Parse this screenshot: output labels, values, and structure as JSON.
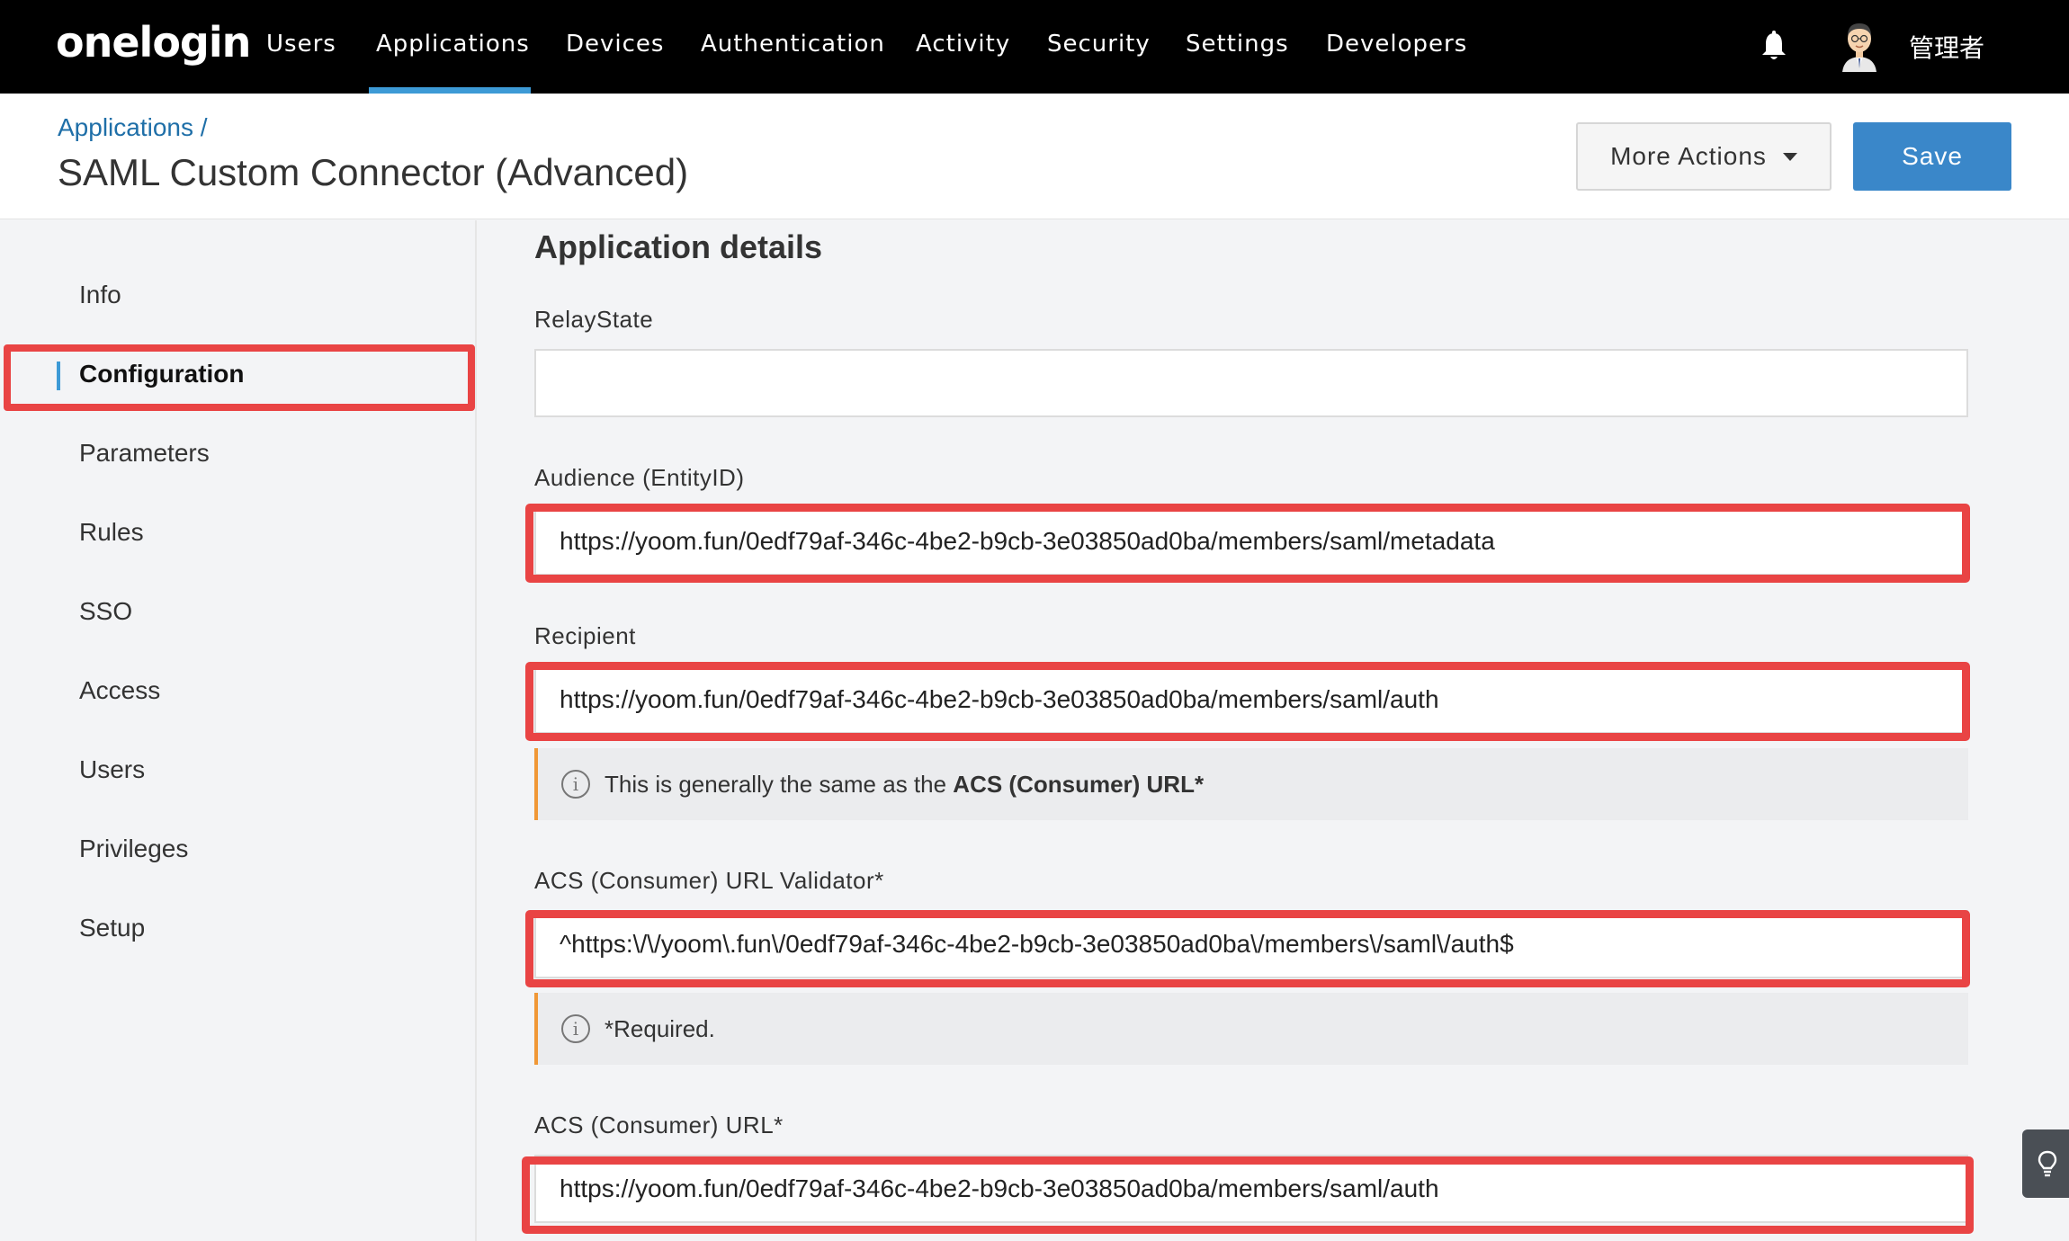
{
  "app": {
    "logo": "onelogin"
  },
  "nav": {
    "items": [
      "Users",
      "Applications",
      "Devices",
      "Authentication",
      "Activity",
      "Security",
      "Settings",
      "Developers"
    ],
    "active": "Applications",
    "user_name": "管理者"
  },
  "header": {
    "breadcrumb": "Applications /",
    "title": "SAML Custom Connector (Advanced)",
    "more_actions_label": "More Actions",
    "save_label": "Save"
  },
  "sidebar": {
    "items": [
      "Info",
      "Configuration",
      "Parameters",
      "Rules",
      "SSO",
      "Access",
      "Users",
      "Privileges",
      "Setup"
    ],
    "active": "Configuration"
  },
  "main": {
    "section_title": "Application details",
    "relay_state": {
      "label": "RelayState",
      "value": ""
    },
    "audience": {
      "label": "Audience (EntityID)",
      "value": "https://yoom.fun/0edf79af-346c-4be2-b9cb-3e03850ad0ba/members/saml/metadata"
    },
    "recipient": {
      "label": "Recipient",
      "value": "https://yoom.fun/0edf79af-346c-4be2-b9cb-3e03850ad0ba/members/saml/auth"
    },
    "recipient_note": {
      "prefix": "This is generally the same as the ",
      "bold": "ACS (Consumer) URL*"
    },
    "acs_validator": {
      "label": "ACS (Consumer) URL Validator*",
      "value": "^https:\\/\\/yoom\\.fun\\/0edf79af-346c-4be2-b9cb-3e03850ad0ba\\/members\\/saml\\/auth$"
    },
    "validator_note": "*Required.",
    "acs_url": {
      "label": "ACS (Consumer) URL*",
      "value": "https://yoom.fun/0edf79af-346c-4be2-b9cb-3e03850ad0ba/members/saml/auth"
    }
  },
  "colors": {
    "nav_bg": "#000000",
    "accent": "#3d9ad6",
    "save_button": "#3a87c9",
    "highlight": "#e94444",
    "note_border": "#f09836"
  },
  "icons": {
    "bell": "bell-icon",
    "avatar": "avatar-icon",
    "info": "info-icon",
    "caret": "caret-down-icon",
    "tip": "lightbulb-icon"
  }
}
